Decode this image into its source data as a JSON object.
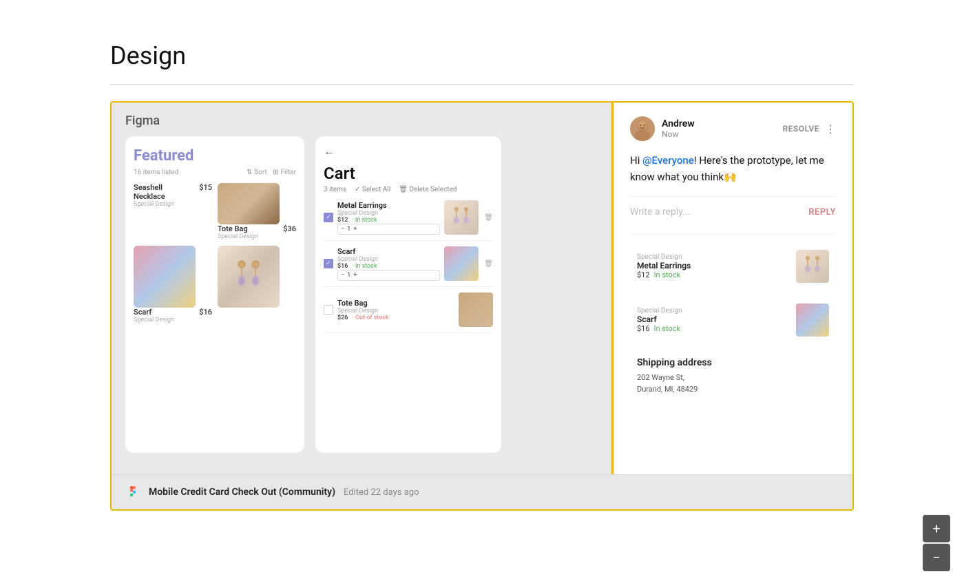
{
  "page": {
    "title": "Design"
  },
  "figma": {
    "label": "Figma",
    "screens": {
      "featured": {
        "title": "Featured",
        "items_count": "16 items listed",
        "sort_label": "Sort",
        "filter_label": "Filter",
        "products": [
          {
            "name": "Seashell Necklace",
            "brand": "Special Design",
            "price": "$15",
            "image_type": "tote"
          },
          {
            "name": "Tote Bag",
            "brand": "Special Design",
            "price": "$36",
            "image_type": "tote"
          },
          {
            "name": "Scarf",
            "brand": "Special Design",
            "price": "$16",
            "image_type": "scarf"
          }
        ]
      },
      "cart": {
        "title": "Cart",
        "items_count": "3 items",
        "select_all": "✓ Select All",
        "delete_selected": "🗑 Delete Selected",
        "items": [
          {
            "name": "Metal Earrings",
            "brand": "Special Design",
            "price": "$12",
            "stock": "In stock",
            "checked": true,
            "image_type": "earrings"
          },
          {
            "name": "Scarf",
            "brand": "Special Design",
            "price": "$16",
            "stock": "In stock",
            "checked": true,
            "image_type": "scarf"
          },
          {
            "name": "Tote Bag",
            "brand": "Special Design",
            "price": "$26",
            "stock": "Out of stock",
            "checked": false,
            "image_type": "tote"
          }
        ]
      }
    }
  },
  "comment": {
    "author": "Andrew",
    "time": "Now",
    "resolve_label": "RESOLVE",
    "more_icon": "⋮",
    "body_prefix": "Hi ",
    "mention": "@Everyone",
    "body_suffix": "! Here's the prototype, let me know what you think🙌",
    "reply_placeholder": "Write a reply...",
    "reply_label": "REPLY"
  },
  "continuation": {
    "items": [
      {
        "name": "Metal Earrings",
        "brand": "Special Design",
        "price": "$12",
        "stock": "In stock",
        "image_type": "earrings"
      },
      {
        "name": "Scarf",
        "brand": "Special Design",
        "price": "$16",
        "stock": "In stock",
        "image_type": "scarf"
      }
    ],
    "shipping": {
      "title": "Shipping address",
      "line1": "202 Wayne St,",
      "line2": "Durand, MI, 48429"
    }
  },
  "footer": {
    "file_name": "Mobile Credit Card Check Out (Community)",
    "edited": "Edited 22 days ago"
  },
  "zoom": {
    "plus": "+",
    "minus": "−"
  }
}
